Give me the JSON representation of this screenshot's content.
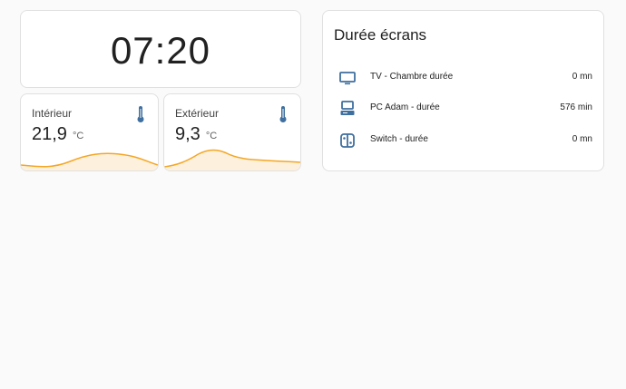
{
  "clock": {
    "time": "07:20"
  },
  "sensors": [
    {
      "name": "Intérieur",
      "value": "21,9",
      "unit": "°C",
      "icon": "thermometer-icon"
    },
    {
      "name": "Extérieur",
      "value": "9,3",
      "unit": "°C",
      "icon": "thermometer-icon"
    }
  ],
  "screens": {
    "title": "Durée écrans",
    "items": [
      {
        "icon": "tv-icon",
        "label": "TV - Chambre durée",
        "value": "0 mn"
      },
      {
        "icon": "desktop-computer-icon",
        "label": "PC Adam - durée",
        "value": "576 min"
      },
      {
        "icon": "nintendo-switch-icon",
        "label": "Switch - durée",
        "value": "0 mn"
      }
    ]
  },
  "colors": {
    "accent_icon": "#3f6f9f",
    "graph_line": "#f5a623",
    "graph_fill": "#fdf1de"
  }
}
